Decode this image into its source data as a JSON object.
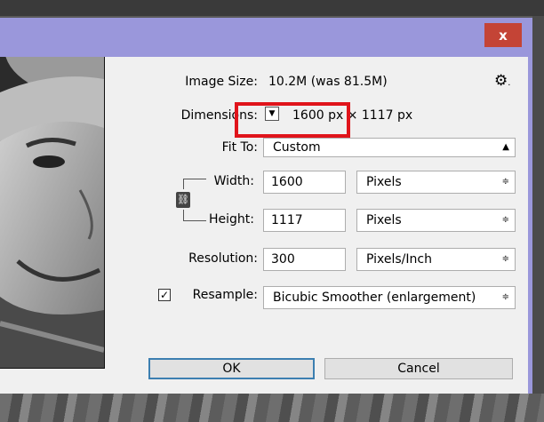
{
  "dialog": {
    "close_label": "x",
    "image_size_label": "Image Size:",
    "image_size_value": "10.2M (was 81.5M)",
    "gear_icon": "gear-icon",
    "dimensions_label": "Dimensions:",
    "dimensions_value": "1600 px  ×  1117 px",
    "fit_to_label": "Fit To:",
    "fit_to_value": "Custom",
    "width_label": "Width:",
    "width_value": "1600",
    "width_unit": "Pixels",
    "height_label": "Height:",
    "height_value": "1117",
    "height_unit": "Pixels",
    "resolution_label": "Resolution:",
    "resolution_value": "300",
    "resolution_unit": "Pixels/Inch",
    "resample_label": "Resample:",
    "resample_checked": true,
    "resample_value": "Bicubic Smoother (enlargement)",
    "ok_label": "OK",
    "cancel_label": "Cancel"
  },
  "colors": {
    "titlebar": "#9a97db",
    "close": "#c44436",
    "highlight": "#e0141b",
    "panel": "#f0f0f0"
  }
}
